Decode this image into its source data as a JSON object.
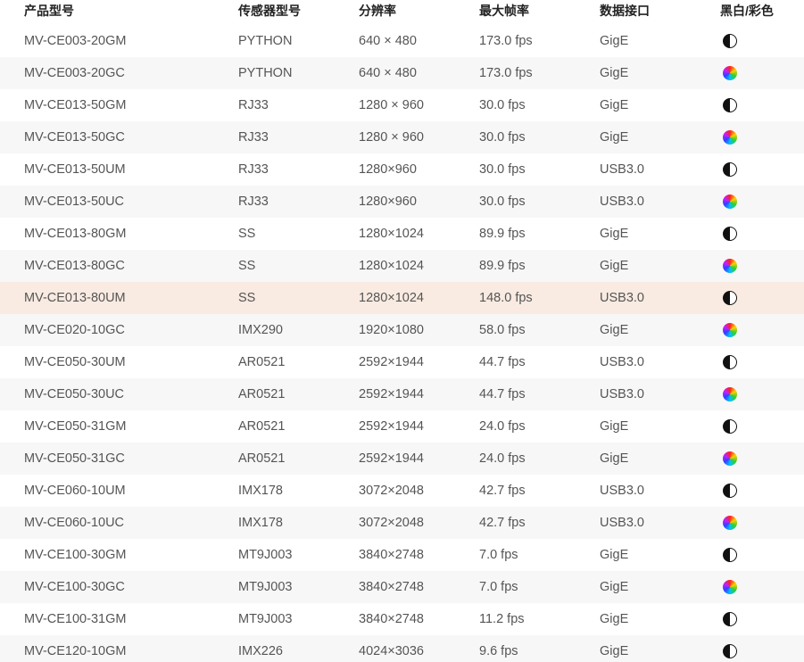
{
  "table": {
    "headers": [
      "产品型号",
      "传感器型号",
      "分辨率",
      "最大帧率",
      "数据接口",
      "黑白/彩色"
    ],
    "rows": [
      {
        "model": "MV-CE003-20GM",
        "sensor": "PYTHON",
        "resolution": "640 × 480",
        "fps": "173.0 fps",
        "interface": "GigE",
        "color_type": "mono-icon"
      },
      {
        "model": "MV-CE003-20GC",
        "sensor": "PYTHON",
        "resolution": "640 × 480",
        "fps": "173.0 fps",
        "interface": "GigE",
        "color_type": "color-icon"
      },
      {
        "model": "MV-CE013-50GM",
        "sensor": "RJ33",
        "resolution": "1280 × 960",
        "fps": "30.0 fps",
        "interface": "GigE",
        "color_type": "mono-icon"
      },
      {
        "model": "MV-CE013-50GC",
        "sensor": "RJ33",
        "resolution": "1280 × 960",
        "fps": "30.0 fps",
        "interface": "GigE",
        "color_type": "color-icon"
      },
      {
        "model": "MV-CE013-50UM",
        "sensor": "RJ33",
        "resolution": "1280×960",
        "fps": "30.0 fps",
        "interface": "USB3.0",
        "color_type": "mono-icon"
      },
      {
        "model": "MV-CE013-50UC",
        "sensor": "RJ33",
        "resolution": "1280×960",
        "fps": "30.0 fps",
        "interface": "USB3.0",
        "color_type": "color-icon"
      },
      {
        "model": "MV-CE013-80GM",
        "sensor": "SS",
        "resolution": "1280×1024",
        "fps": "89.9 fps",
        "interface": "GigE",
        "color_type": "mono-icon"
      },
      {
        "model": "MV-CE013-80GC",
        "sensor": "SS",
        "resolution": "1280×1024",
        "fps": "89.9 fps",
        "interface": "GigE",
        "color_type": "color-icon"
      },
      {
        "model": "MV-CE013-80UM",
        "sensor": "SS",
        "resolution": "1280×1024",
        "fps": "148.0 fps",
        "interface": "USB3.0",
        "color_type": "mono-icon"
      },
      {
        "model": "MV-CE020-10GC",
        "sensor": "IMX290",
        "resolution": "1920×1080",
        "fps": "58.0 fps",
        "interface": "GigE",
        "color_type": "color-icon"
      },
      {
        "model": "MV-CE050-30UM",
        "sensor": "AR0521",
        "resolution": "2592×1944",
        "fps": "44.7 fps",
        "interface": "USB3.0",
        "color_type": "mono-icon"
      },
      {
        "model": "MV-CE050-30UC",
        "sensor": "AR0521",
        "resolution": "2592×1944",
        "fps": "44.7 fps",
        "interface": "USB3.0",
        "color_type": "color-icon"
      },
      {
        "model": "MV-CE050-31GM",
        "sensor": "AR0521",
        "resolution": "2592×1944",
        "fps": "24.0 fps",
        "interface": "GigE",
        "color_type": "mono-icon"
      },
      {
        "model": "MV-CE050-31GC",
        "sensor": "AR0521",
        "resolution": "2592×1944",
        "fps": "24.0 fps",
        "interface": "GigE",
        "color_type": "color-icon"
      },
      {
        "model": "MV-CE060-10UM",
        "sensor": "IMX178",
        "resolution": "3072×2048",
        "fps": "42.7 fps",
        "interface": "USB3.0",
        "color_type": "mono-icon"
      },
      {
        "model": "MV-CE060-10UC",
        "sensor": "IMX178",
        "resolution": "3072×2048",
        "fps": "42.7 fps",
        "interface": "USB3.0",
        "color_type": "color-icon"
      },
      {
        "model": "MV-CE100-30GM",
        "sensor": "MT9J003",
        "resolution": "3840×2748",
        "fps": "7.0 fps",
        "interface": "GigE",
        "color_type": "mono-icon"
      },
      {
        "model": "MV-CE100-30GC",
        "sensor": "MT9J003",
        "resolution": "3840×2748",
        "fps": "7.0 fps",
        "interface": "GigE",
        "color_type": "color-icon"
      },
      {
        "model": "MV-CE100-31GM",
        "sensor": "MT9J003",
        "resolution": "3840×2748",
        "fps": "11.2 fps",
        "interface": "GigE",
        "color_type": "mono-icon"
      },
      {
        "model": "MV-CE120-10GM",
        "sensor": "IMX226",
        "resolution": "4024×3036",
        "fps": "9.6 fps",
        "interface": "GigE",
        "color_type": "mono-icon"
      }
    ],
    "highlighted_model": "MV-CE013-80UM"
  },
  "colors": {
    "highlight_row": "#f9ebe2",
    "stripe_row": "#f7f7f7",
    "text": "#555555",
    "header_text": "#222222"
  }
}
